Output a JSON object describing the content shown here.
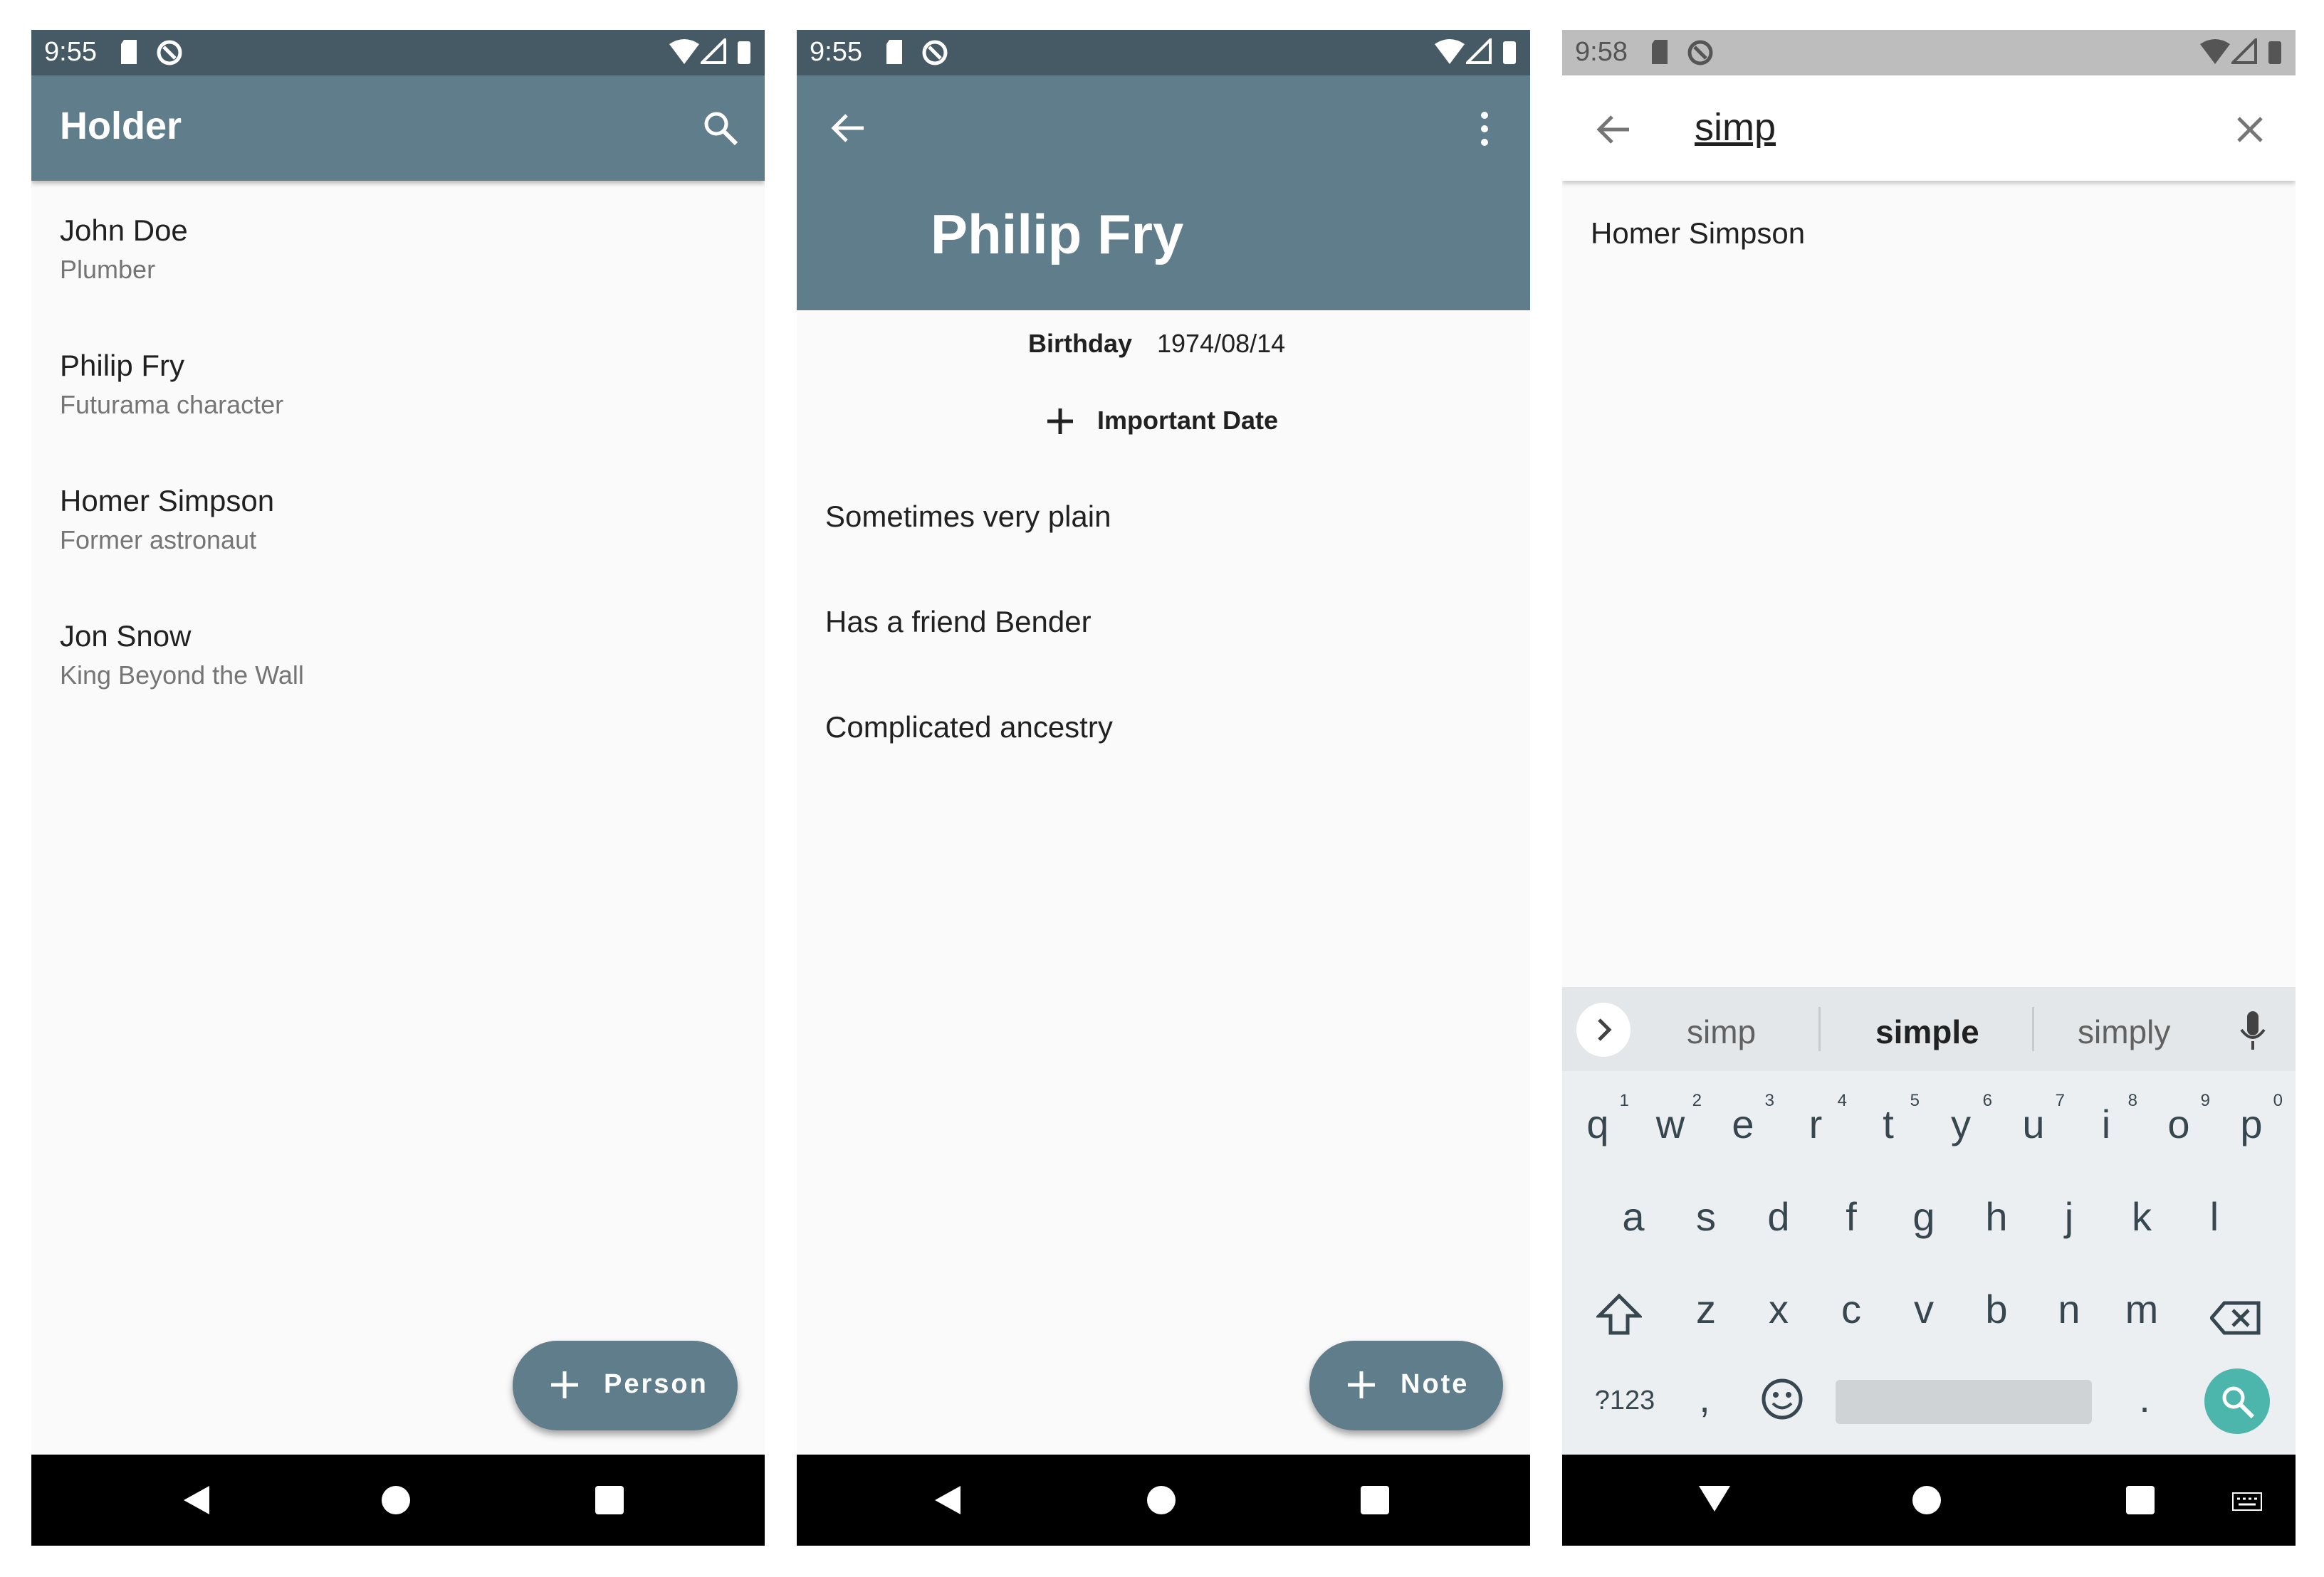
{
  "phone1": {
    "status": {
      "time": "9:55"
    },
    "appbar": {
      "title": "Holder"
    },
    "people": [
      {
        "name": "John Doe",
        "subtitle": "Plumber"
      },
      {
        "name": "Philip Fry",
        "subtitle": "Futurama character"
      },
      {
        "name": "Homer Simpson",
        "subtitle": "Former astronaut"
      },
      {
        "name": "Jon Snow",
        "subtitle": "King Beyond the Wall"
      }
    ],
    "fab_label": "Person"
  },
  "phone2": {
    "status": {
      "time": "9:55"
    },
    "person_name": "Philip Fry",
    "birthday_label": "Birthday",
    "birthday_value": "1974/08/14",
    "add_date_label": "Important Date",
    "notes": [
      "Sometimes very plain",
      "Has a friend Bender",
      "Complicated ancestry"
    ],
    "fab_label": "Note"
  },
  "phone3": {
    "status": {
      "time": "9:58"
    },
    "search_query": "simp",
    "results": [
      "Homer Simpson"
    ],
    "suggestions": [
      "simp",
      "simple",
      "simply"
    ],
    "keyboard": {
      "row1": [
        "q",
        "w",
        "e",
        "r",
        "t",
        "y",
        "u",
        "i",
        "o",
        "p"
      ],
      "row1_hints": [
        "1",
        "2",
        "3",
        "4",
        "5",
        "6",
        "7",
        "8",
        "9",
        "0"
      ],
      "row2": [
        "a",
        "s",
        "d",
        "f",
        "g",
        "h",
        "j",
        "k",
        "l"
      ],
      "row3": [
        "z",
        "x",
        "c",
        "v",
        "b",
        "n",
        "m"
      ],
      "symbols": "?123",
      "comma": ",",
      "period": "."
    }
  },
  "colors": {
    "appbar": "#607d8b",
    "statusbar": "#455a64",
    "search_fab": "#4db6ac"
  }
}
